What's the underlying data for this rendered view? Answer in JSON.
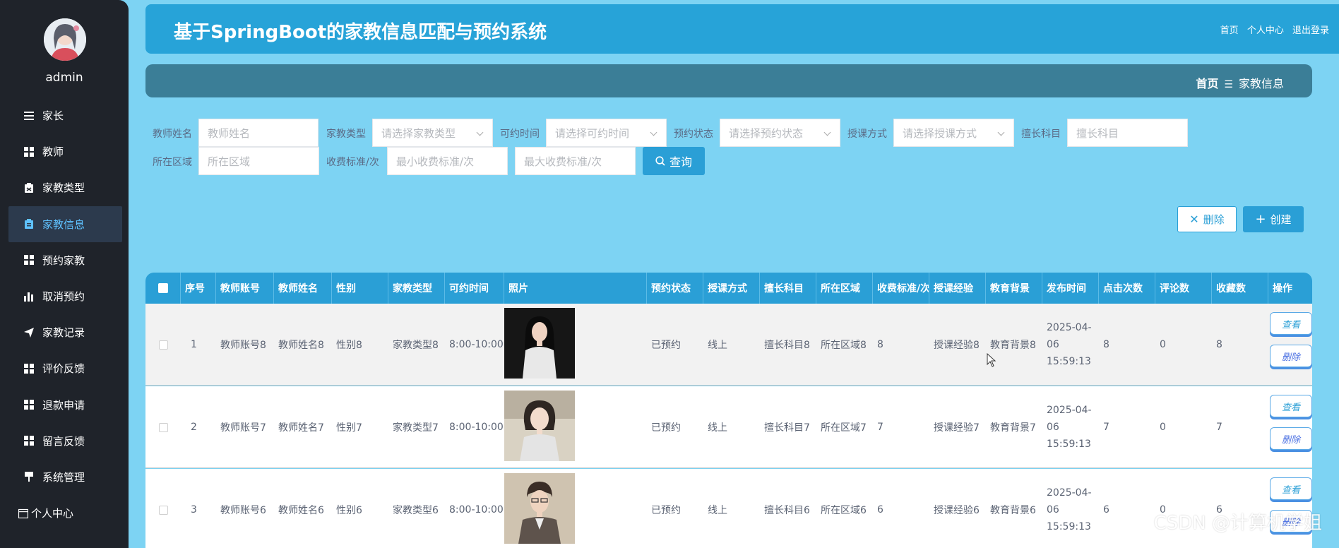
{
  "sidebar": {
    "username": "admin",
    "items": [
      {
        "label": "家长",
        "icon": "list-icon"
      },
      {
        "label": "教师",
        "icon": "grid-icon"
      },
      {
        "label": "家教类型",
        "icon": "clipboard-icon"
      },
      {
        "label": "家教信息",
        "icon": "clipboard-icon"
      },
      {
        "label": "预约家教",
        "icon": "grid-icon"
      },
      {
        "label": "取消预约",
        "icon": "bar-chart-icon"
      },
      {
        "label": "家教记录",
        "icon": "send-icon"
      },
      {
        "label": "评价反馈",
        "icon": "grid-icon"
      },
      {
        "label": "退款申请",
        "icon": "grid-icon"
      },
      {
        "label": "留言反馈",
        "icon": "grid-icon"
      },
      {
        "label": "系统管理",
        "icon": "pin-icon"
      },
      {
        "label": "个人中心",
        "icon": "calendar-icon"
      }
    ],
    "active_index": 3
  },
  "header": {
    "title": "基于SpringBoot的家教信息匹配与预约系统",
    "links": [
      "首页",
      "个人中心",
      "退出登录"
    ]
  },
  "breadcrumb": {
    "home": "首页",
    "sep": "☰",
    "current": "家教信息"
  },
  "filters": {
    "teacher_name": {
      "label": "教师姓名",
      "placeholder": "教师姓名"
    },
    "type": {
      "label": "家教类型",
      "placeholder": "请选择家教类型"
    },
    "available_time": {
      "label": "可约时间",
      "placeholder": "请选择可约时间"
    },
    "booking_status": {
      "label": "预约状态",
      "placeholder": "请选择预约状态"
    },
    "teaching_mode": {
      "label": "授课方式",
      "placeholder": "请选择授课方式"
    },
    "subject": {
      "label": "擅长科目",
      "placeholder": "擅长科目"
    },
    "area": {
      "label": "所在区域",
      "placeholder": "所在区域"
    },
    "fee": {
      "label": "收费标准/次",
      "min_placeholder": "最小收费标准/次",
      "max_placeholder": "最大收费标准/次"
    },
    "search_button": "查询"
  },
  "actions": {
    "delete": "删除",
    "create": "创建"
  },
  "table": {
    "columns": [
      "序号",
      "教师账号",
      "教师姓名",
      "性别",
      "家教类型",
      "可约时间",
      "照片",
      "预约状态",
      "授课方式",
      "擅长科目",
      "所在区域",
      "收费标准/次",
      "授课经验",
      "教育背景",
      "发布时间",
      "点击次数",
      "评论数",
      "收藏数",
      "操作"
    ],
    "view_label": "查看",
    "delete_label": "删除",
    "rows": [
      {
        "no": "1",
        "account": "教师账号8",
        "name": "教师姓名8",
        "gender": "性别8",
        "type": "家教类型8",
        "time": "8:00-10:00",
        "status": "已预约",
        "mode": "线上",
        "subject": "擅长科目8",
        "area": "所在区域8",
        "fee": "8",
        "exp": "授课经验8",
        "edu": "教育背景8",
        "published": "2025-04-06 15:59:13",
        "clicks": "8",
        "comments": "0",
        "favorites": "8"
      },
      {
        "no": "2",
        "account": "教师账号7",
        "name": "教师姓名7",
        "gender": "性别7",
        "type": "家教类型7",
        "time": "8:00-10:00",
        "status": "已预约",
        "mode": "线上",
        "subject": "擅长科目7",
        "area": "所在区域7",
        "fee": "7",
        "exp": "授课经验7",
        "edu": "教育背景7",
        "published": "2025-04-06 15:59:13",
        "clicks": "7",
        "comments": "0",
        "favorites": "7"
      },
      {
        "no": "3",
        "account": "教师账号6",
        "name": "教师姓名6",
        "gender": "性别6",
        "type": "家教类型6",
        "time": "8:00-10:00",
        "status": "已预约",
        "mode": "线上",
        "subject": "擅长科目6",
        "area": "所在区域6",
        "fee": "6",
        "exp": "授课经验6",
        "edu": "教育背景6",
        "published": "2025-04-06 15:59:13",
        "clicks": "6",
        "comments": "0",
        "favorites": "6"
      }
    ]
  },
  "watermark": "CSDN @计算机学姐"
}
